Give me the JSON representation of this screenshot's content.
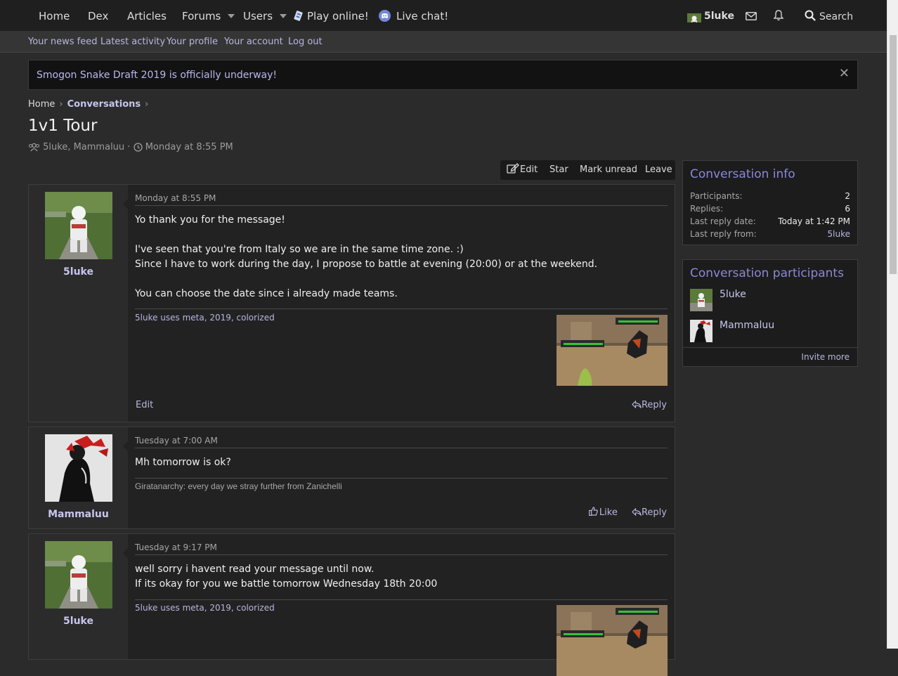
{
  "nav": {
    "home": "Home",
    "dex": "Dex",
    "articles": "Articles",
    "forums": "Forums",
    "users": "Users",
    "play_online": "Play online!",
    "live_chat": "Live chat!",
    "account_name": "5luke",
    "search": "Search"
  },
  "subnav": {
    "news_feed": "Your news feed",
    "latest_activity": "Latest activity",
    "profile": "Your profile",
    "account": "Your account",
    "logout": "Log out"
  },
  "notice": {
    "text": "Smogon Snake Draft 2019 is officially underway!",
    "close": "✕"
  },
  "breadcrumb": {
    "home": "Home",
    "current": "Conversations"
  },
  "conversation": {
    "title": "1v1 Tour",
    "participants": "5luke, Mammaluu",
    "date": "Monday at 8:55 PM"
  },
  "actions": {
    "edit": "Edit",
    "star": "Star",
    "mark_unread": "Mark unread",
    "leave": "Leave"
  },
  "messages": [
    {
      "author": "5luke",
      "date": "Monday at 8:55 PM",
      "lines": [
        "Yo thank you for the message!",
        "",
        "I've seen that you're from Italy so we are in the same time zone. :)",
        "Since I have to work during the day, I propose to battle at evening (20:00) or at the weekend.",
        "",
        "You can choose the date since i already made teams."
      ],
      "signature": "5luke uses meta, 2019, colorized",
      "edit": "Edit",
      "reply": "Reply"
    },
    {
      "author": "Mammaluu",
      "date": "Tuesday at 7:00 AM",
      "lines": [
        "Mh tomorrow is ok?"
      ],
      "signature": "Giratanarchy: every day we stray further from Zanichelli",
      "like": "Like",
      "reply": "Reply"
    },
    {
      "author": "5luke",
      "date": "Tuesday at 9:17 PM",
      "lines": [
        "well sorry i havent read your message until now.",
        "If its okay for you we battle tomorrow Wednesday 18th 20:00"
      ],
      "signature": "5luke uses meta, 2019, colorized"
    }
  ],
  "info": {
    "title": "Conversation info",
    "participants_label": "Participants:",
    "participants_value": "2",
    "replies_label": "Replies:",
    "replies_value": "6",
    "last_reply_date_label": "Last reply date:",
    "last_reply_date_value": "Today at 1:42 PM",
    "last_reply_from_label": "Last reply from:",
    "last_reply_from_value": "5luke"
  },
  "participants_block": {
    "title": "Conversation participants",
    "people": [
      "5luke",
      "Mammaluu"
    ],
    "invite": "Invite more"
  },
  "colors": {
    "accent": "#8a88d9",
    "link": "#b8b6e0",
    "page_bg": "#2b2b2b",
    "nav_bg": "#1f1f1f"
  }
}
